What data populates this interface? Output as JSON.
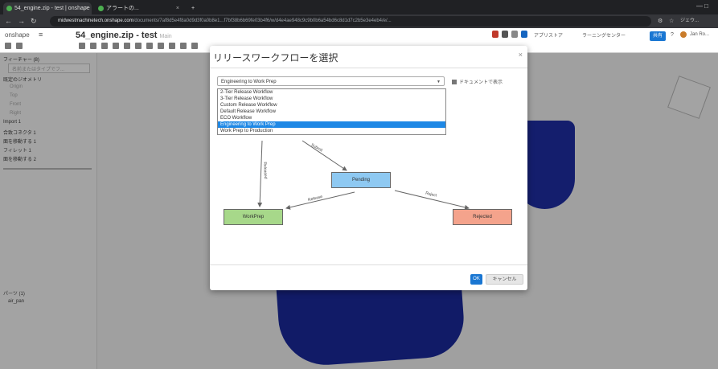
{
  "browser": {
    "tabs": [
      {
        "title": "54_engine.zip - test | onshape"
      },
      {
        "title": "アラートの..."
      }
    ],
    "new_tab": "+",
    "url_host": "midwestmachinetech.onshape.com",
    "url_path": "/documents/7af8d5e4f8a0d9d3f0a0b8e1...f7bf38b6b69fe03b4f6/w/d4e4ae948c9c9b0b6a54bd6c8d1d7c2b5e3e4eb4/e/...",
    "user": "ジェウ...",
    "window_controls": "— □"
  },
  "header": {
    "brand": "onshape",
    "title": "54_engine.zip - test",
    "branch": "Main",
    "right_buttons": [
      "アプリストア",
      "ラーニングセンター"
    ],
    "share": "共有",
    "user": "Jan Ro..."
  },
  "left_panel": {
    "header": "フィーチャー (8)",
    "filter_placeholder": "名前またはタイプでフ...",
    "items": [
      {
        "label": "既定のジオメトリ",
        "dim": false
      },
      {
        "label": "Origin",
        "dim": true
      },
      {
        "label": "Top",
        "dim": true
      },
      {
        "label": "Front",
        "dim": true
      },
      {
        "label": "Right",
        "dim": true
      },
      {
        "label": "Import 1",
        "dim": false
      },
      {
        "label": "合致コネクタ 1",
        "dim": false
      },
      {
        "label": "面を移動する 1",
        "dim": false
      },
      {
        "label": "フィレット 1",
        "dim": false
      },
      {
        "label": "面を移動する 2",
        "dim": false
      }
    ],
    "parts_header": "パーツ (1)",
    "part_name": "air_pan"
  },
  "dialog": {
    "title": "リリースワークフローを選択",
    "close": "×",
    "selected": "Engineering to Work Prep",
    "doc_link": "ドキュメントで表示",
    "options": [
      "2-Tier Release Workflow",
      "3-Tier Release Workflow",
      "Custom Release Workflow",
      "Default Release Workflow",
      "ECO Workflow",
      "Engineering to Work Prep",
      "Work Prep to Production"
    ],
    "states": {
      "pending": "Pending",
      "workprep": "WorkPrep",
      "rejected": "Rejected"
    },
    "edges": {
      "submit": "Submit",
      "released": "Released",
      "release": "Release",
      "reject": "Reject"
    },
    "ok": "OK",
    "cancel": "キャンセル"
  },
  "colors": {
    "pending": "#8ec9f2",
    "workprep": "#a7d88a",
    "rejected": "#f4a38c",
    "accent": "#1976d2"
  }
}
